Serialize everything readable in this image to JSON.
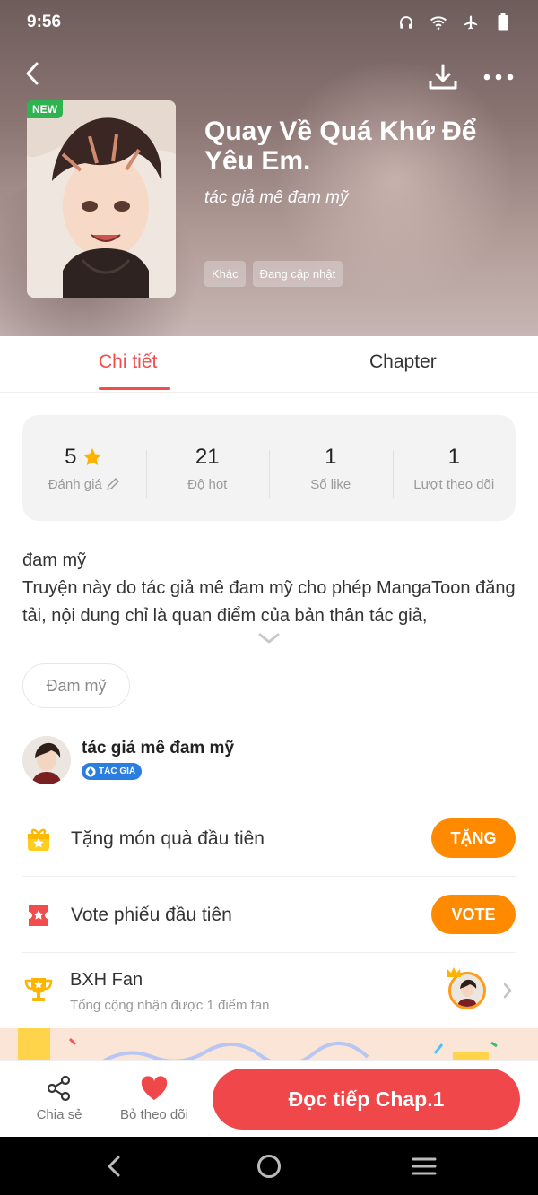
{
  "status_bar": {
    "time": "9:56"
  },
  "header": {
    "new_badge": "NEW",
    "title": "Quay Về Quá Khứ Để Yêu Em.",
    "author": "tác giả mê đam mỹ",
    "tags": [
      "Khác",
      "Đang cập nhật"
    ]
  },
  "tabs": [
    {
      "label": "Chi tiết",
      "active": true
    },
    {
      "label": "Chapter",
      "active": false
    }
  ],
  "stats": [
    {
      "value": "5",
      "label": "Đánh giá"
    },
    {
      "value": "21",
      "label": "Độ hot"
    },
    {
      "value": "1",
      "label": "Số like"
    },
    {
      "value": "1",
      "label": "Lượt theo dõi"
    }
  ],
  "description": {
    "line1": "đam mỹ",
    "line2": "Truyện này do tác giả mê đam mỹ cho phép MangaToon đăng tải, nội dung chỉ là quan điểm của bản thân tác giả,"
  },
  "genre_chip": "Đam mỹ",
  "author_section": {
    "name": "tác giả mê đam mỹ",
    "badge": "TÁC GIẢ"
  },
  "gift_row": {
    "label": "Tặng món quà đầu tiên",
    "button": "TẶNG"
  },
  "vote_row": {
    "label": "Vote phiếu đầu tiên",
    "button": "VOTE"
  },
  "fan_row": {
    "title": "BXH Fan",
    "subtitle": "Tổng cộng nhận được 1 điểm fan"
  },
  "bottom_bar": {
    "share_label": "Chia sẻ",
    "unfollow_label": "Bỏ theo dõi",
    "read_label": "Đọc tiếp Chap.1"
  },
  "colors": {
    "accent": "#f04d4d",
    "orange": "#ff8a00",
    "read_button": "#f0474a",
    "new_badge": "#2fb351",
    "author_badge": "#2a7de1"
  }
}
